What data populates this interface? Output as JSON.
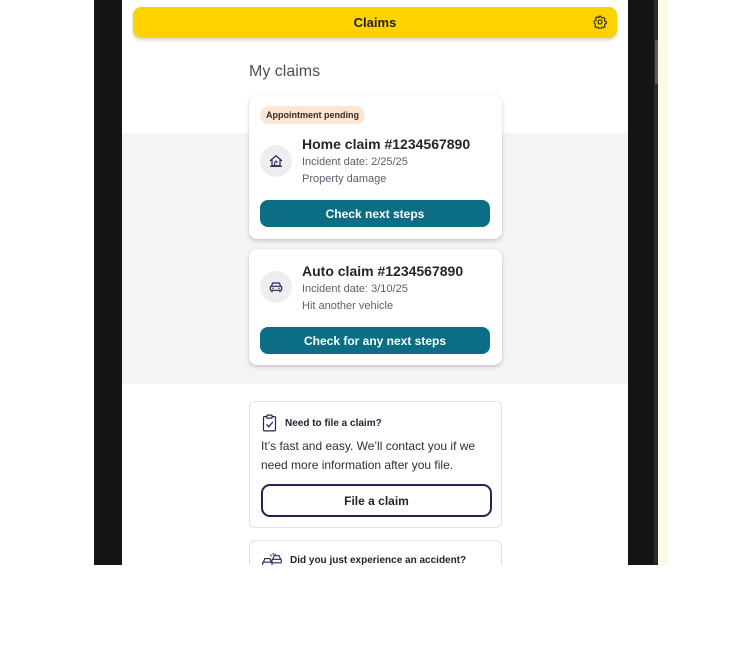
{
  "header": {
    "title": "Claims",
    "settings_icon": "gear-icon"
  },
  "page": {
    "title": "My claims"
  },
  "claims": [
    {
      "badge": "Appointment pending",
      "icon": "house-damage-icon",
      "title": "Home claim #1234567890",
      "incident": "Incident date: 2/25/25",
      "description": "Property damage",
      "button": "Check next steps"
    },
    {
      "icon": "car-icon",
      "title": "Auto claim #1234567890",
      "incident": "Incident date: 3/10/25",
      "description": "Hit another vehicle",
      "button": "Check for any next steps"
    }
  ],
  "file_claim": {
    "icon": "clipboard-check-icon",
    "heading": "Need to file a claim?",
    "body": "It’s fast and easy. We’ll contact you if we need more information after you file.",
    "button": "File a claim"
  },
  "accident": {
    "icon": "car-accident-icon",
    "heading": "Did you just experience an accident?"
  },
  "colors": {
    "brand_yellow": "#ffd200",
    "primary_teal": "#0b6e85",
    "badge_bg": "#fde6d3",
    "navy": "#1f2750"
  }
}
